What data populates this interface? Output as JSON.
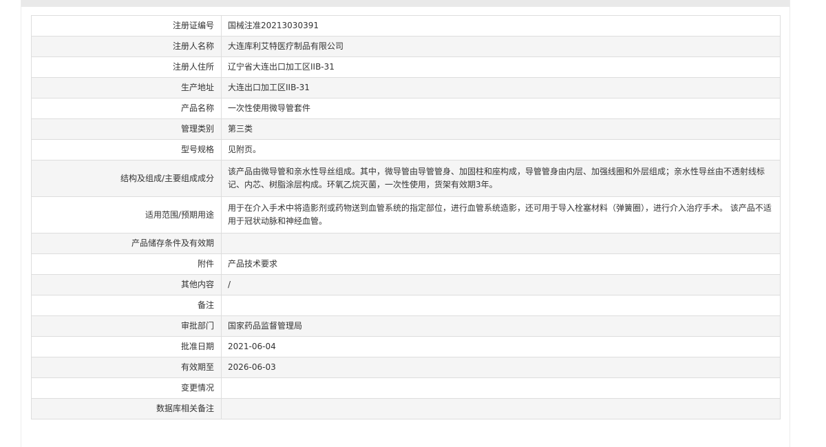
{
  "header": {
    "crumb": ""
  },
  "rows": [
    {
      "label": "注册证编号",
      "value": "国械注准20213030391"
    },
    {
      "label": "注册人名称",
      "value": "大连库利艾特医疗制品有限公司"
    },
    {
      "label": "注册人住所",
      "value": "辽宁省大连出口加工区IIB-31"
    },
    {
      "label": "生产地址",
      "value": "大连出口加工区IIB-31"
    },
    {
      "label": "产品名称",
      "value": "一次性使用微导管套件"
    },
    {
      "label": "管理类别",
      "value": "第三类"
    },
    {
      "label": "型号规格",
      "value": "见附页。"
    },
    {
      "label": "结构及组成/主要组成成分",
      "value": "该产品由微导管和亲水性导丝组成。其中，微导管由导管管身、加固柱和座构成，导管管身由内层、加强线圈和外层组成；亲水性导丝由不透射线标记、内芯、树脂涂层构成。环氧乙烷灭菌，一次性使用，货架有效期3年。"
    },
    {
      "label": "适用范围/预期用途",
      "value": "用于在介入手术中将造影剂或药物送到血管系统的指定部位，进行血管系统造影，还可用于导入栓塞材料（弹簧圈），进行介入治疗手术。 该产品不适用于冠状动脉和神经血管。"
    },
    {
      "label": "产品储存条件及有效期",
      "value": ""
    },
    {
      "label": "附件",
      "value": "产品技术要求"
    },
    {
      "label": "其他内容",
      "value": "/"
    },
    {
      "label": "备注",
      "value": ""
    },
    {
      "label": "审批部门",
      "value": "国家药品监督管理局"
    },
    {
      "label": "批准日期",
      "value": "2021-06-04"
    },
    {
      "label": "有效期至",
      "value": "2026-06-03"
    },
    {
      "label": "变更情况",
      "value": ""
    },
    {
      "label": "数据库相关备注",
      "value": ""
    }
  ]
}
